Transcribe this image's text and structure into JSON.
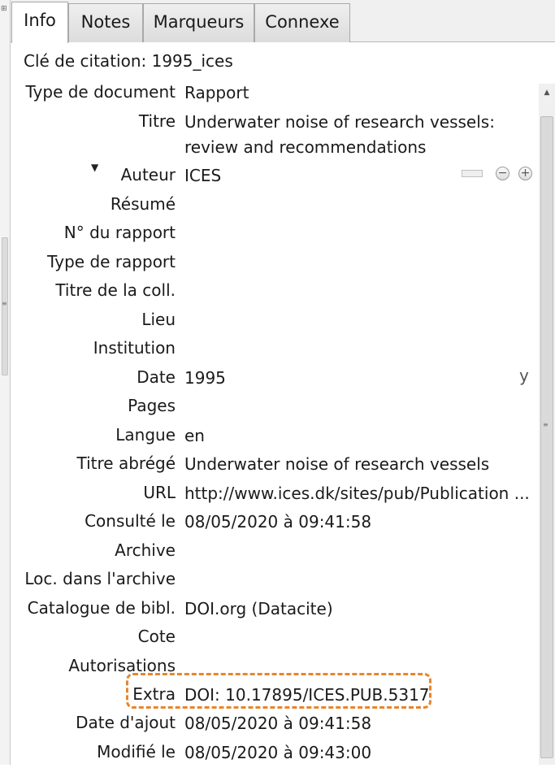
{
  "tabs": [
    {
      "label": "Info",
      "active": true
    },
    {
      "label": "Notes",
      "active": false
    },
    {
      "label": "Marqueurs",
      "active": false
    },
    {
      "label": "Connexe",
      "active": false
    }
  ],
  "citation_key": "Clé de citation: 1995_ices",
  "fields": {
    "item_type": {
      "label": "Type de document",
      "value": "Rapport"
    },
    "title": {
      "label": "Titre",
      "value": "Underwater noise of research vessels: review and recommendations"
    },
    "author": {
      "label": "Auteur",
      "value": "ICES"
    },
    "abstract": {
      "label": "Résumé",
      "value": ""
    },
    "report_number": {
      "label": "N° du rapport",
      "value": ""
    },
    "report_type": {
      "label": "Type de rapport",
      "value": ""
    },
    "series_title": {
      "label": "Titre de la coll.",
      "value": ""
    },
    "place": {
      "label": "Lieu",
      "value": ""
    },
    "institution": {
      "label": "Institution",
      "value": ""
    },
    "date": {
      "label": "Date",
      "value": "1995",
      "ymd": "y"
    },
    "pages": {
      "label": "Pages",
      "value": ""
    },
    "language": {
      "label": "Langue",
      "value": "en"
    },
    "short_title": {
      "label": "Titre abrégé",
      "value": "Underwater noise of research vessels"
    },
    "url": {
      "label": "URL",
      "value": "http://www.ices.dk/sites/pub/Publication ..."
    },
    "accessed": {
      "label": "Consulté le",
      "value": "08/05/2020 à 09:41:58"
    },
    "archive": {
      "label": "Archive",
      "value": ""
    },
    "archive_location": {
      "label": "Loc. dans l'archive",
      "value": ""
    },
    "library_catalog": {
      "label": "Catalogue de bibl.",
      "value": "DOI.org (Datacite)"
    },
    "call_number": {
      "label": "Cote",
      "value": ""
    },
    "rights": {
      "label": "Autorisations",
      "value": ""
    },
    "extra": {
      "label": "Extra",
      "value": "DOI: 10.17895/ICES.PUB.5317"
    },
    "date_added": {
      "label": "Date d'ajout",
      "value": "08/05/2020 à 09:41:58"
    },
    "modified": {
      "label": "Modifié le",
      "value": "08/05/2020 à 09:43:00"
    }
  },
  "icons": {
    "expand": "triangle-down-icon",
    "switch_mode": "field-mode-switch-icon",
    "remove": "minus-circle-icon",
    "add": "plus-circle-icon"
  },
  "colors": {
    "highlight": "#e6862e"
  }
}
